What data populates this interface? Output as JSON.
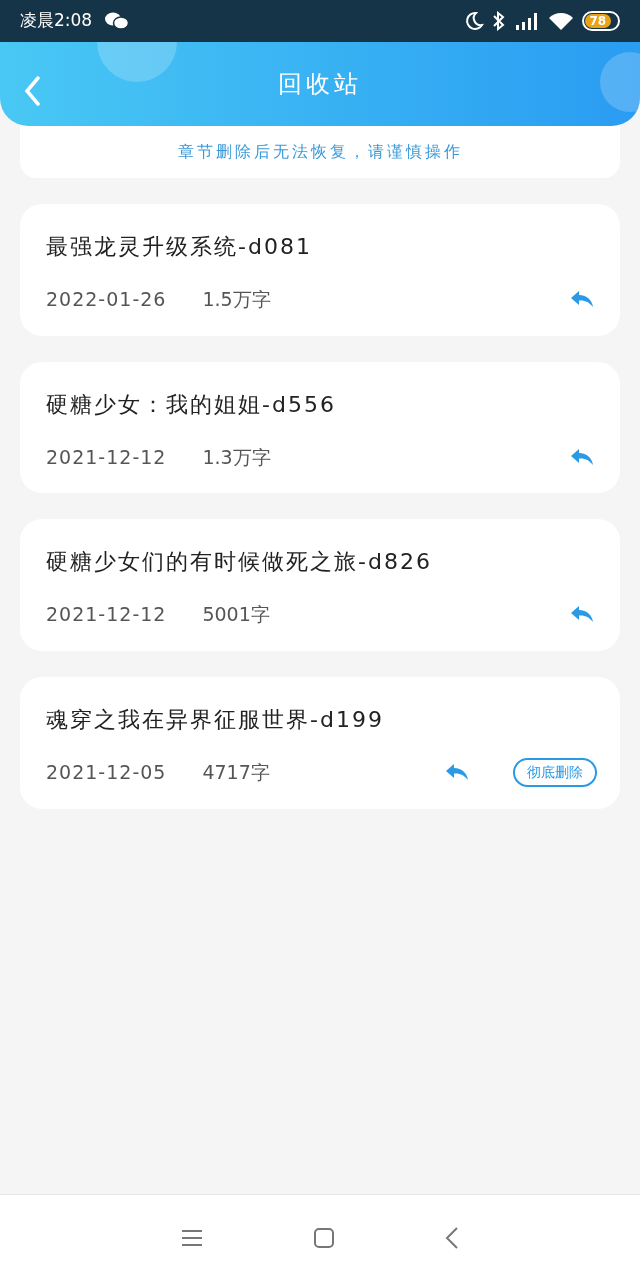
{
  "status_bar": {
    "time": "凌晨2:08",
    "battery": "78"
  },
  "header": {
    "title": "回收站"
  },
  "notice": "章节删除后无法恢复，请谨慎操作",
  "items": [
    {
      "title": "最强龙灵升级系统-d081",
      "date": "2022-01-26",
      "words": "1.5万字"
    },
    {
      "title": "硬糖少女：我的姐姐-d556",
      "date": "2021-12-12",
      "words": "1.3万字"
    },
    {
      "title": "硬糖少女们的有时候做死之旅-d826",
      "date": "2021-12-12",
      "words": "5001字"
    },
    {
      "title": "魂穿之我在异界征服世界-d199",
      "date": "2021-12-05",
      "words": "4717字",
      "delete_label": "彻底删除"
    }
  ]
}
